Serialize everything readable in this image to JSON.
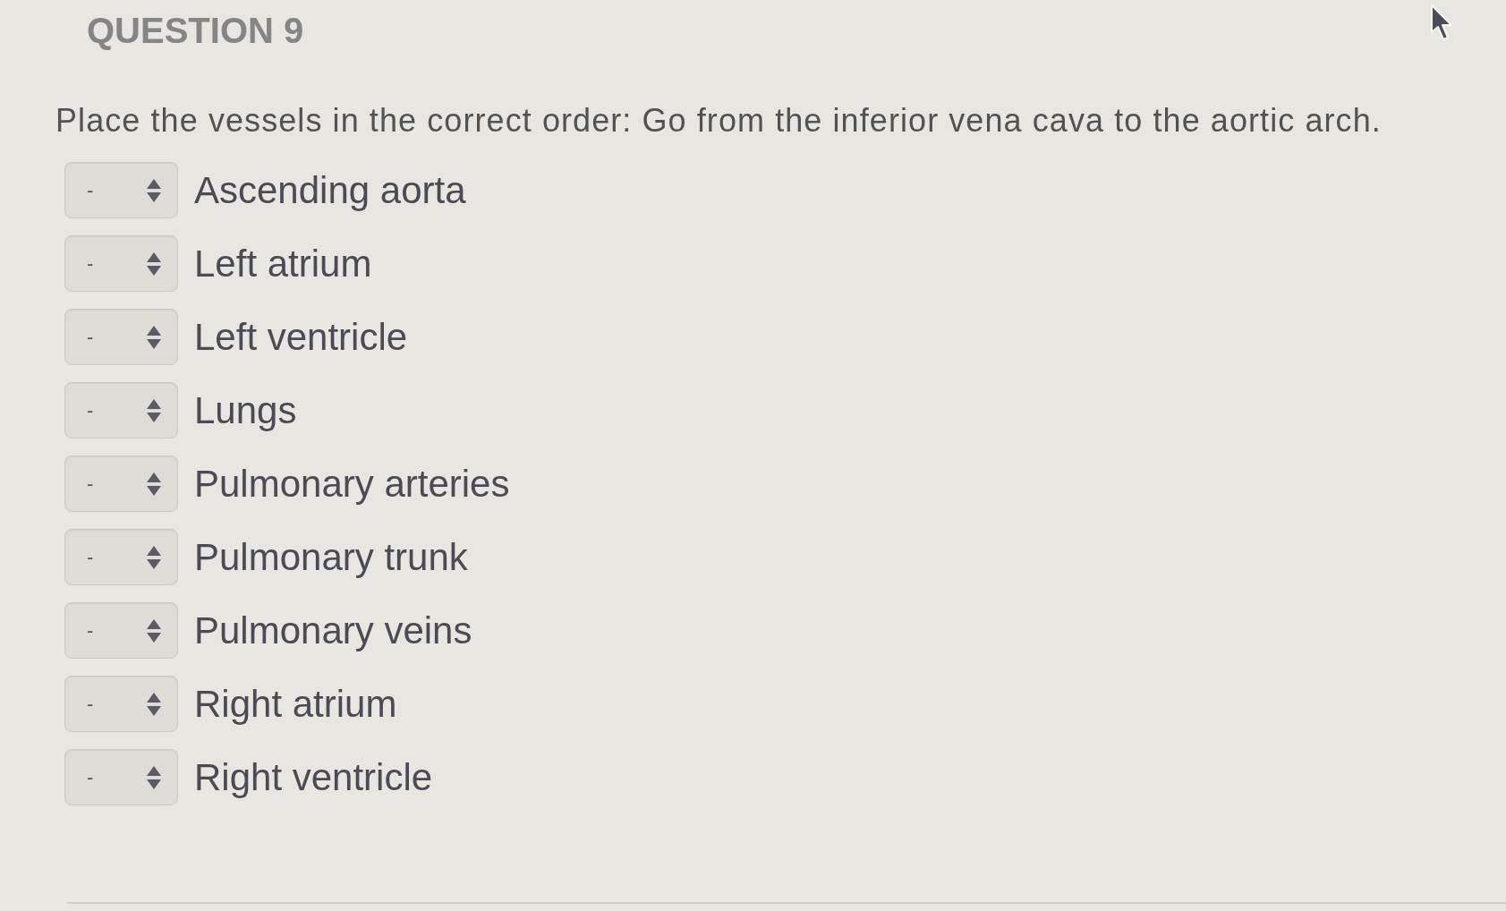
{
  "question": {
    "heading": "QUESTION 9",
    "prompt": "Place the vessels in the correct order: Go from the inferior vena cava to the aortic arch.",
    "items": [
      {
        "value": "-",
        "label": "Ascending aorta"
      },
      {
        "value": "-",
        "label": "Left atrium"
      },
      {
        "value": "-",
        "label": "Left ventricle"
      },
      {
        "value": "-",
        "label": "Lungs"
      },
      {
        "value": "-",
        "label": "Pulmonary arteries"
      },
      {
        "value": "-",
        "label": "Pulmonary trunk"
      },
      {
        "value": "-",
        "label": "Pulmonary veins"
      },
      {
        "value": "-",
        "label": "Right atrium"
      },
      {
        "value": "-",
        "label": "Right ventricle"
      }
    ]
  }
}
